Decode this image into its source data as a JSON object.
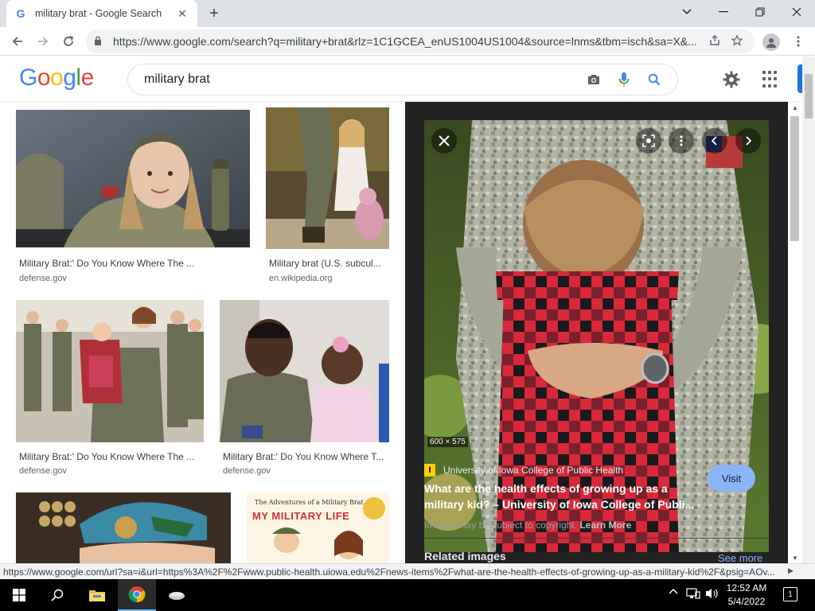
{
  "browser": {
    "tab_title": "military brat - Google Search",
    "tab_favicon": "G",
    "close_tab": "✕",
    "new_tab": "+",
    "url": "https://www.google.com/search?q=military+brat&rlz=1C1GCEA_enUS1004US1004&source=lnms&tbm=isch&sa=X&...",
    "status_url": "https://www.google.com/url?sa=i&url=https%3A%2F%2Fwww.public-health.uiowa.edu%2Fnews-items%2Fwhat-are-the-health-effects-of-growing-up-as-a-military-kid%2F&psig=AOv..."
  },
  "google": {
    "logo": [
      "G",
      "o",
      "o",
      "g",
      "l",
      "e"
    ],
    "logo_colors": [
      "#4285F4",
      "#EA4335",
      "#FBBC05",
      "#4285F4",
      "#34A853",
      "#EA4335"
    ],
    "query": "military brat"
  },
  "results": [
    {
      "caption": "Military Brat:' Do You Know Where The ...",
      "source": "defense.gov"
    },
    {
      "caption": "Military brat (U.S. subcul...",
      "source": "en.wikipedia.org"
    },
    {
      "caption": "Military Brat:' Do You Know Where The ...",
      "source": "defense.gov"
    },
    {
      "caption": "Military Brat:' Do You Know Where T...",
      "source": "defense.gov"
    },
    {
      "caption": "",
      "source": "",
      "book_title": "The Adventures of a Military Brat",
      "book_subtitle": "MY MILITARY LIFE"
    }
  ],
  "preview": {
    "dimensions": "600 × 575",
    "source_name": "University of Iowa College of Public Health",
    "source_favicon": "I",
    "title": "What are the health effects of growing up as a military kid? – University of Iowa College of Publi...",
    "visit_label": "Visit",
    "copyright_text": "Images may be subject to copyright.",
    "learn_more": "Learn More",
    "related_label": "Related images",
    "see_more": "See more"
  },
  "taskbar": {
    "time": "12:52 AM",
    "date": "5/4/2022",
    "notification_count": "1"
  },
  "colors": {
    "accent": "#1a73e8",
    "preview_bg": "#222222",
    "visit_btn": "#8ab4f8"
  }
}
